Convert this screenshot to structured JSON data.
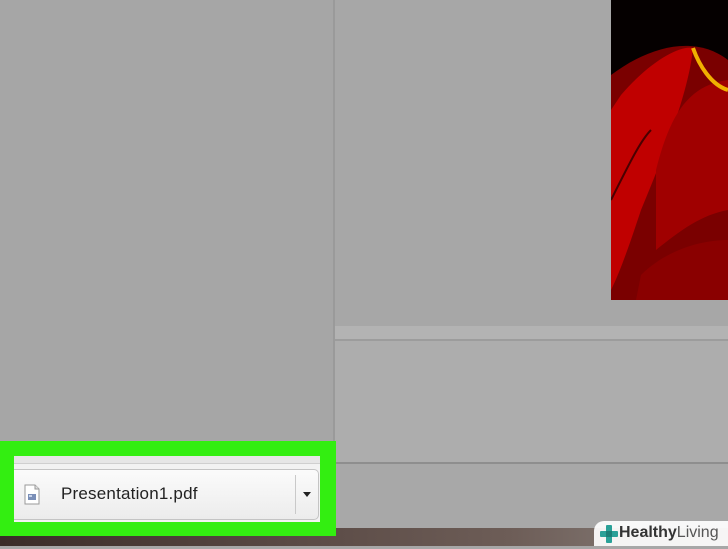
{
  "download_bar": {
    "file_name": "Presentation1.pdf",
    "file_icon": "pdf-file-icon",
    "menu_icon": "caret-down-icon"
  },
  "watermark": {
    "bold": "Healthy",
    "light": "Living"
  },
  "colors": {
    "highlight": "#33ee11",
    "pane_gray": "#a7a7a7",
    "slide_red": "#b00000",
    "slide_black": "#050000"
  }
}
